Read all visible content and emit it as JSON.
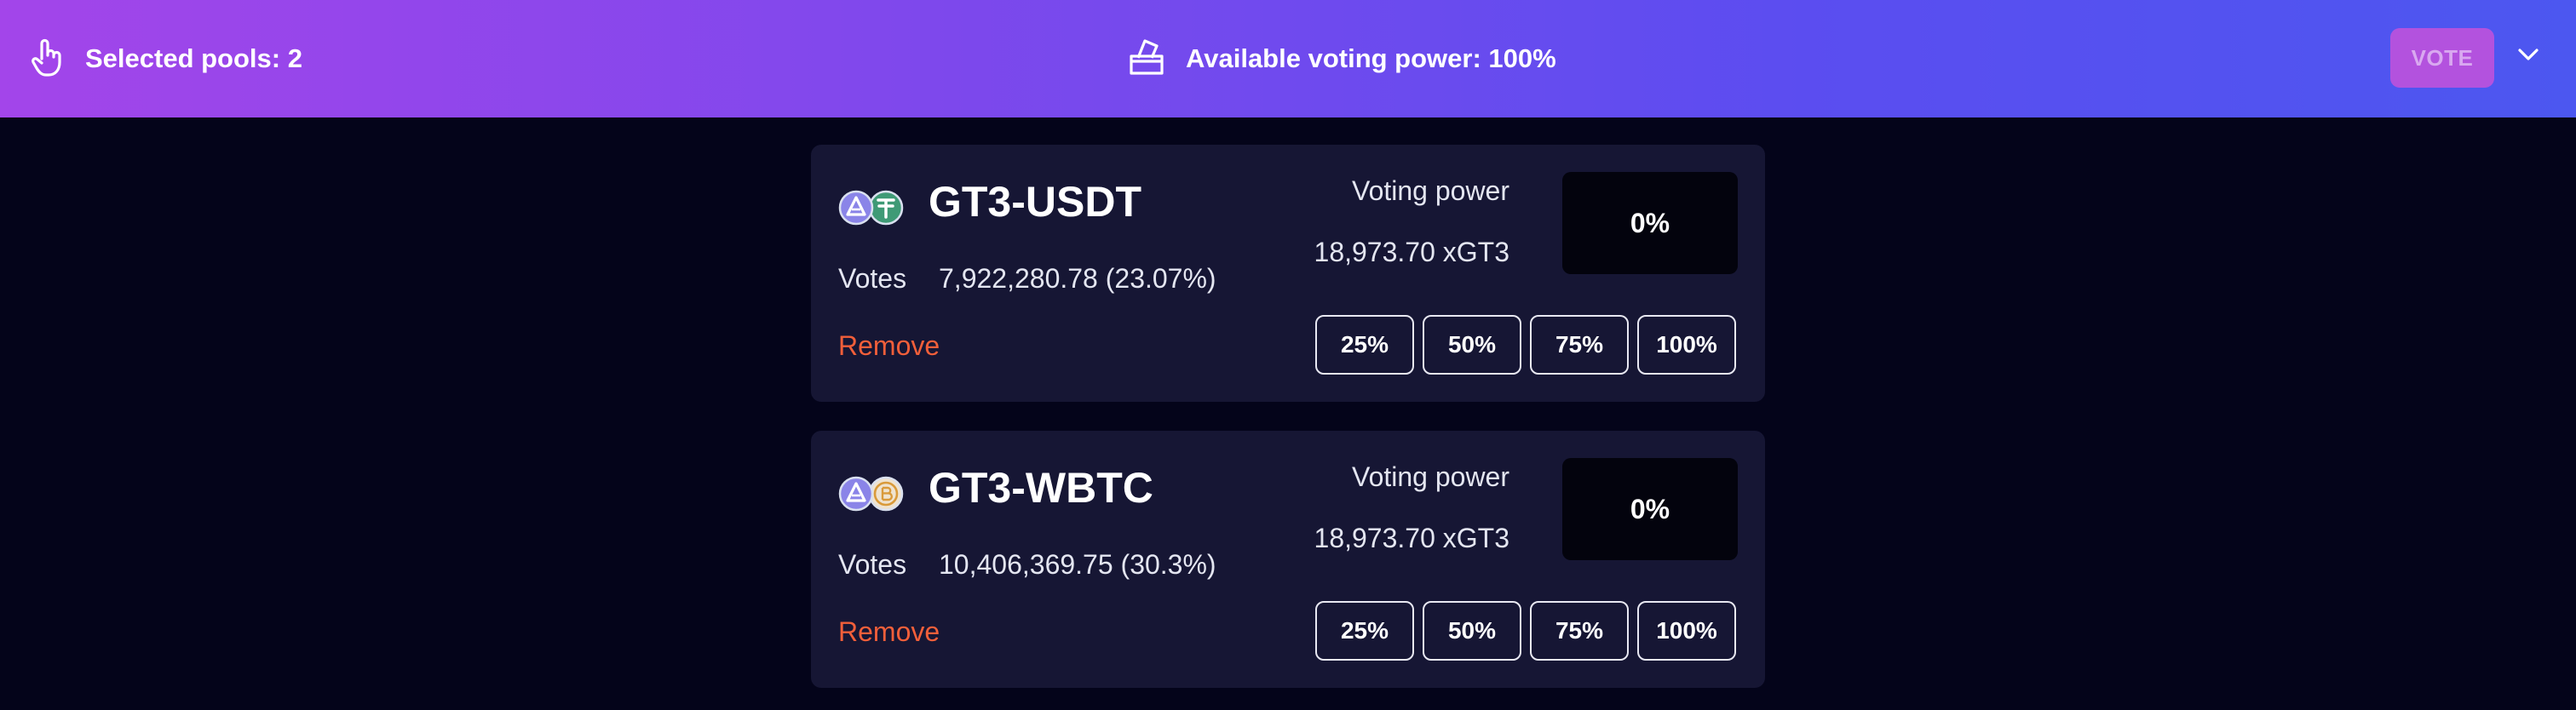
{
  "header": {
    "selected_pools_label": "Selected pools: 2",
    "voting_power_label": "Available voting power: 100%",
    "vote_button_label": "VOTE"
  },
  "pools": [
    {
      "name": "GT3-USDT",
      "tokens": [
        "gt3-token-icon",
        "usdt-token-icon"
      ],
      "votes_label": "Votes",
      "votes_value": "7,922,280.78 (23.07%)",
      "remove_label": "Remove",
      "voting_power_label": "Voting power",
      "voting_power_amount": "18,973.70 xGT3",
      "percent_value": "0%",
      "quick_options": [
        "25%",
        "50%",
        "75%",
        "100%"
      ]
    },
    {
      "name": "GT3-WBTC",
      "tokens": [
        "gt3-token-icon",
        "wbtc-token-icon"
      ],
      "votes_label": "Votes",
      "votes_value": "10,406,369.75 (30.3%)",
      "remove_label": "Remove",
      "voting_power_label": "Voting power",
      "voting_power_amount": "18,973.70 xGT3",
      "percent_value": "0%",
      "quick_options": [
        "25%",
        "50%",
        "75%",
        "100%"
      ]
    }
  ],
  "colors": {
    "background": "#04041a",
    "card": "#161634",
    "remove": "#f25f3a",
    "vote_button": "#b352de",
    "gt3_token": "#8a84e8",
    "usdt_token": "#3f9a76",
    "wbtc_token": "#e6c8a0"
  }
}
